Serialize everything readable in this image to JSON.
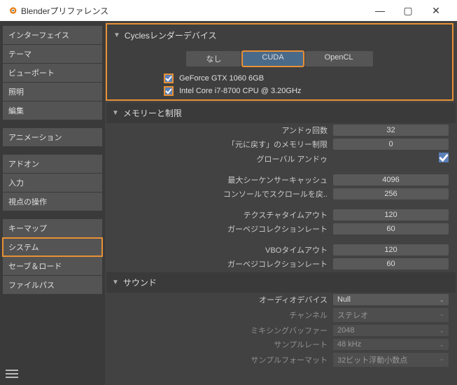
{
  "title": "Blenderプリファレンス",
  "sidebar": [
    {
      "label": "インターフェイス"
    },
    {
      "label": "テーマ"
    },
    {
      "label": "ビューポート"
    },
    {
      "label": "照明"
    },
    {
      "label": "編集"
    },
    {
      "label": "アニメーション"
    },
    {
      "label": "アドオン"
    },
    {
      "label": "入力"
    },
    {
      "label": "視点の操作"
    },
    {
      "label": "キーマップ"
    },
    {
      "label": "システム",
      "active": true
    },
    {
      "label": "セーブ＆ロード"
    },
    {
      "label": "ファイルパス"
    }
  ],
  "cycles": {
    "header": "Cyclesレンダーデバイス",
    "tabs": {
      "none": "なし",
      "cuda": "CUDA",
      "opencl": "OpenCL"
    },
    "devices": [
      {
        "label": "GeForce GTX 1060 6GB"
      },
      {
        "label": "Intel Core i7-8700 CPU @ 3.20GHz"
      }
    ]
  },
  "memory": {
    "header": "メモリーと制限",
    "undo_steps_label": "アンドゥ回数",
    "undo_steps": "32",
    "undo_mem_label": "「元に戻す」のメモリー制限",
    "undo_mem": "0",
    "global_undo_label": "グローバル アンドゥ",
    "seq_cache_label": "最大シーケンサーキャッシュ",
    "seq_cache": "4096",
    "console_scroll_label": "コンソールでスクロールを戻..",
    "console_scroll": "256",
    "tex_timeout_label": "テクスチャタイムアウト",
    "tex_timeout": "120",
    "gc_rate_label": "ガーベジコレクションレート",
    "gc_rate": "60",
    "vbo_timeout_label": "VBOタイムアウト",
    "vbo_timeout": "120",
    "gc_rate2_label": "ガーベジコレクションレート",
    "gc_rate2": "60"
  },
  "sound": {
    "header": "サウンド",
    "audio_device_label": "オーディオデバイス",
    "audio_device": "Null",
    "channels_label": "チャンネル",
    "channels": "ステレオ",
    "mix_buffer_label": "ミキシングバッファー",
    "mix_buffer": "2048",
    "sample_rate_label": "サンプルレート",
    "sample_rate": "48 kHz",
    "sample_format_label": "サンプルフォーマット",
    "sample_format": "32ビット浮動小数点"
  }
}
